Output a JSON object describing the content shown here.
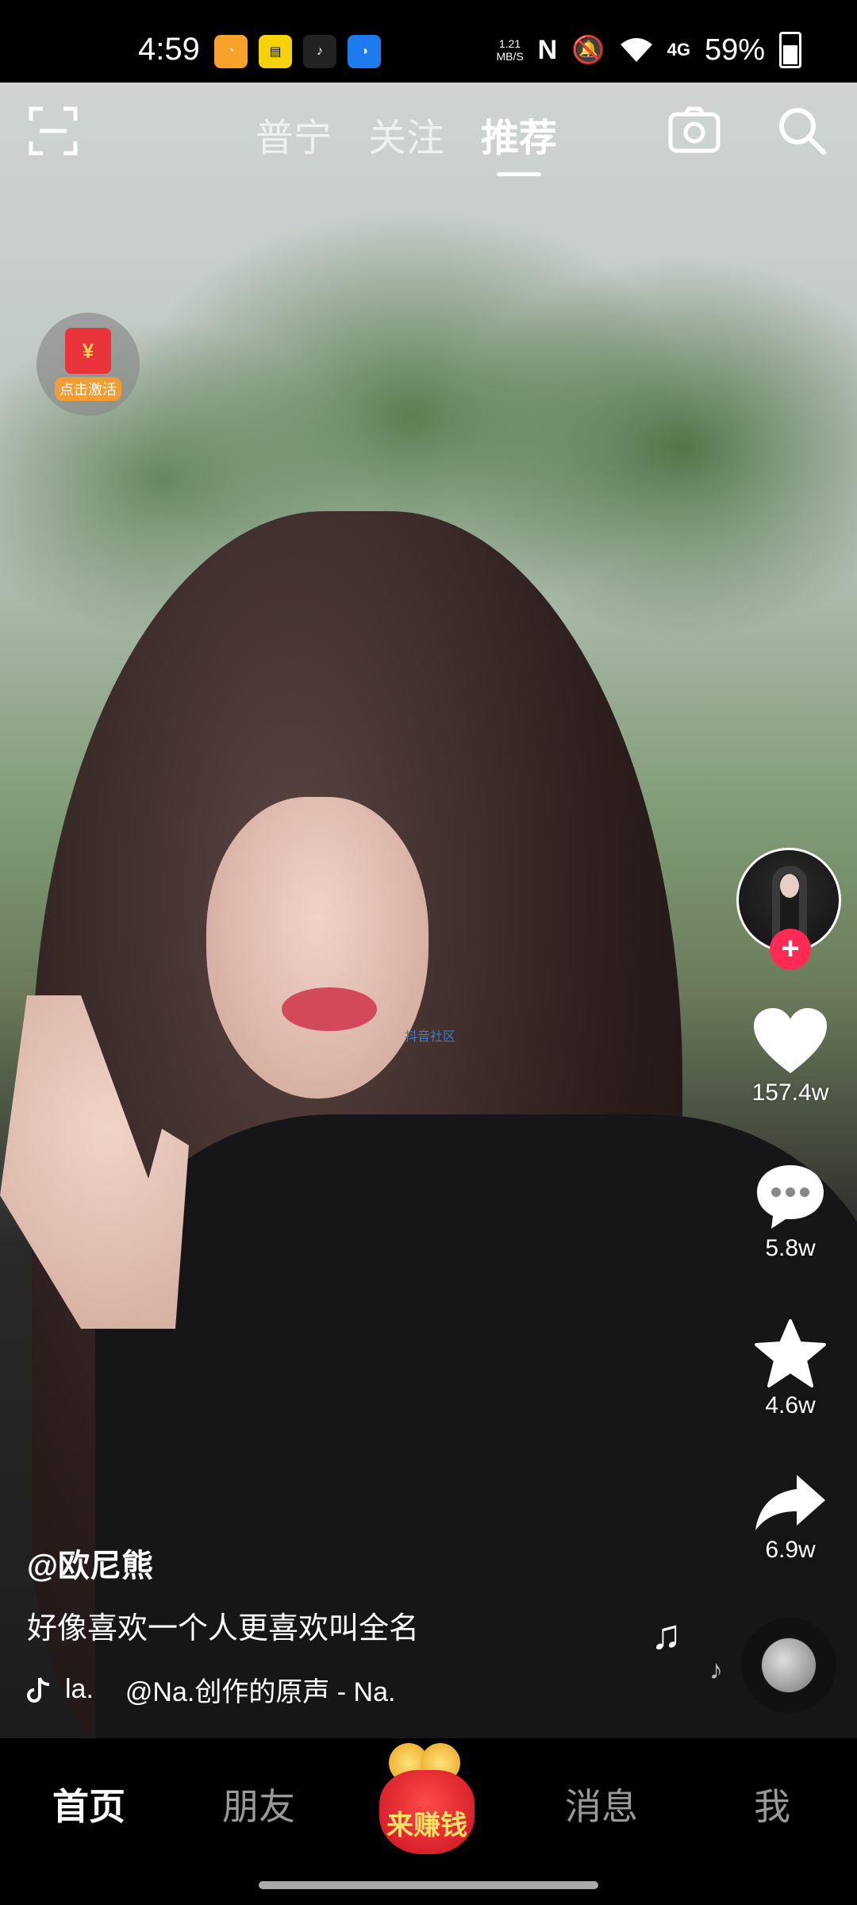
{
  "status_bar": {
    "time": "4:59",
    "net_speed_value": "1.21",
    "net_speed_unit": "MB/S",
    "network": "4G",
    "battery": "59%"
  },
  "top_nav": {
    "tabs": [
      {
        "label": "普宁"
      },
      {
        "label": "关注"
      },
      {
        "label": "推荐"
      }
    ],
    "active_tab": "推荐"
  },
  "redpacket": {
    "label": "点击激活"
  },
  "watermark": "抖音社区",
  "actions": {
    "likes": "157.4w",
    "comments": "5.8w",
    "favorites": "4.6w",
    "shares": "6.9w"
  },
  "post": {
    "author": "@欧尼熊",
    "caption": "好像喜欢一个人更喜欢叫全名",
    "sound_prefix": "la.",
    "sound": "@Na.创作的原声 - Na."
  },
  "bottom_nav": {
    "home": "首页",
    "friends": "朋友",
    "earn": "来赚钱",
    "messages": "消息",
    "me": "我"
  },
  "colors": {
    "follow_button": "#fe2c55",
    "earn_bag": "#e8343a",
    "earn_text": "#ffe266"
  }
}
